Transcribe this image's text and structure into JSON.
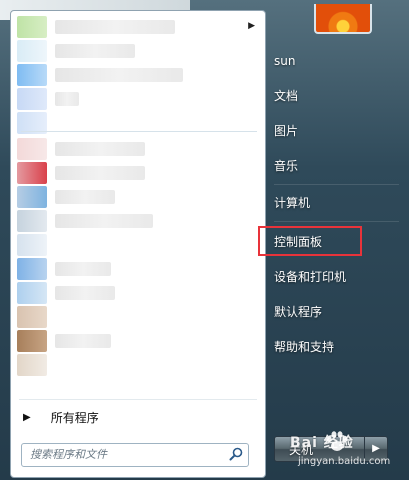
{
  "right_pane": {
    "user_name": "sun",
    "items": [
      {
        "label": "文档"
      },
      {
        "label": "图片"
      },
      {
        "label": "音乐"
      },
      {
        "label": "计算机"
      },
      {
        "label": "控制面板"
      },
      {
        "label": "设备和打印机"
      },
      {
        "label": "默认程序"
      },
      {
        "label": "帮助和支持"
      }
    ],
    "shutdown_label": "关机"
  },
  "left_pane": {
    "all_programs": "所有程序",
    "search_placeholder": "搜索程序和文件"
  },
  "watermark": {
    "brand": "Bai  经验",
    "url": "jingyan.baidu.com"
  },
  "colors": {
    "highlight": "#e8333a",
    "right_pane_text": "#ffffff"
  }
}
